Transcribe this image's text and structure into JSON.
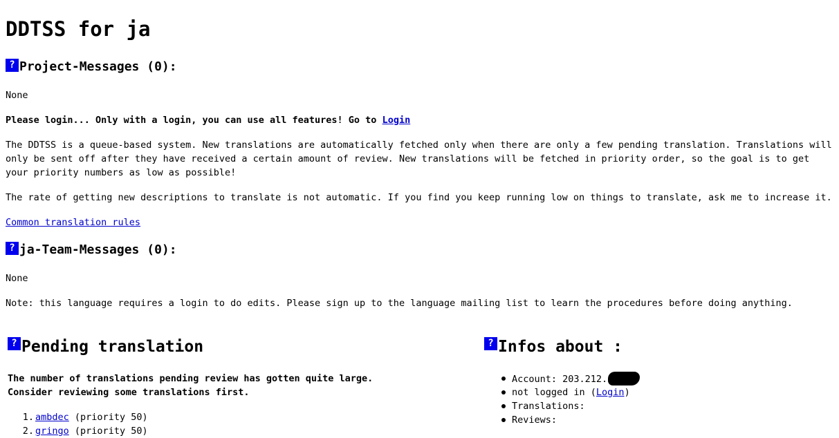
{
  "page": {
    "title": "DDTSS for ja"
  },
  "help_icon_glyph": "?",
  "project_messages": {
    "heading": "Project-Messages (0):",
    "body": "None"
  },
  "login_prompt": {
    "text": "Please login... Only with a login, you can use all features! Go to ",
    "link": "Login"
  },
  "intro_paragraph": "The DDTSS is a queue-based system. New translations are automatically fetched only when there are only a few pending translation. Translations will only be sent off after they have received a certain amount of review. New translations will be fetched in priority order, so the goal is to get your priority numbers as low as possible!",
  "rate_paragraph": "The rate of getting new descriptions to translate is not automatic. If you find you keep running low on things to translate, ask me to increase it.",
  "common_rules_link": "Common translation rules",
  "team_messages": {
    "heading": "ja-Team-Messages (0):",
    "body": "None"
  },
  "note": "Note: this language requires a login to do edits. Please sign up to the language mailing list to learn the procedures before doing anything.",
  "pending": {
    "heading": "Pending translation",
    "warning_line1": "The number of translations pending review has gotten quite large.",
    "warning_line2": "Consider reviewing some translations first.",
    "items": [
      {
        "num": "1.",
        "name": "ambdec",
        "priority": "(priority 50)"
      },
      {
        "num": "2.",
        "name": "gringo",
        "priority": "(priority 50)"
      }
    ]
  },
  "infos": {
    "heading": "Infos about :",
    "account_label": "Account: 203.212.",
    "not_logged_prefix": "not logged in (",
    "login_link": "Login",
    "not_logged_suffix": ")",
    "translations_label": "Translations:",
    "reviews_label": "Reviews:"
  },
  "colors": {
    "link": "#0000cc",
    "help_icon_bg": "#0000ee",
    "text": "#000000",
    "background": "#ffffff"
  }
}
